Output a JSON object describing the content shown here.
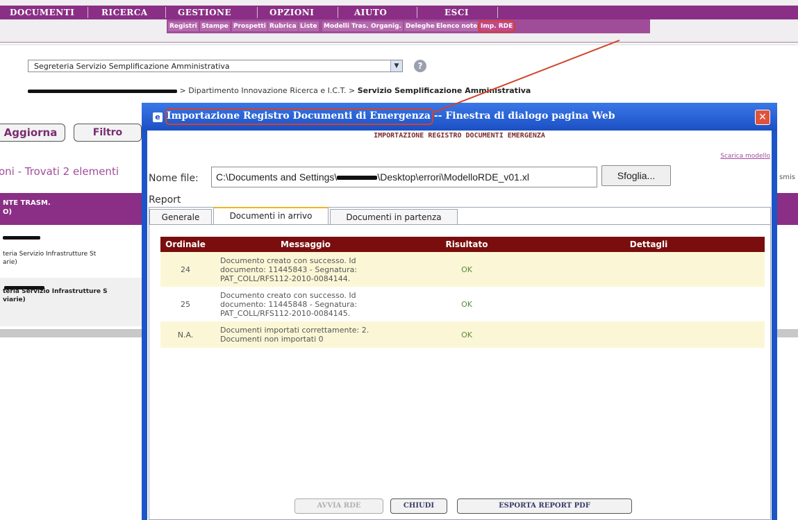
{
  "nav": {
    "main": [
      "DOCUMENTI",
      "RICERCA",
      "GESTIONE",
      "OPZIONI",
      "AIUTO",
      "ESCI"
    ],
    "sub": [
      "Registri",
      "Stampe",
      "Prospetti",
      "Rubrica",
      "Liste",
      "Modelli Tras.",
      "Organig.",
      "Deleghe",
      "Elenco note",
      "Imp. RDE"
    ]
  },
  "office": {
    "selected": "Segreteria Servizio Semplificazione Amministrativa",
    "breadcrumb_mid": "> Dipartimento Innovazione Ricerca e I.C.T. >",
    "breadcrumb_last": "Servizio Semplificazione Amministrativa"
  },
  "background": {
    "aggiorna_label": "Aggiorna",
    "filtro_label": "Filtro",
    "found_text": "oni - Trovati 2 elementi",
    "column_header_1": "NTE TRASM.",
    "column_header_2": "O)",
    "row1_line1": "teria Servizio Infrastrutture St",
    "row1_line2": "arie)",
    "row2_line1": "teria Servizio Infrastrutture S",
    "row2_line2": "viarie)",
    "right_fragment": "smis"
  },
  "dialog": {
    "title_main": "Importazione Registro Documenti di Emergenza",
    "title_suffix": " -- Finestra di dialogo pagina Web",
    "heading": "IMPORTAZIONE REGISTRO DOCUMENTI EMERGENZA",
    "scarica": "Scarica modello",
    "nome_label": "Nome file:",
    "file_prefix": "C:\\Documents and Settings\\",
    "file_suffix": "\\Desktop\\errori\\ModelloRDE_v01.xl",
    "sfoglia": "Sfoglia...",
    "report_label": "Report",
    "tabs": [
      "Generale",
      "Documenti in arrivo",
      "Documenti in partenza"
    ],
    "columns": [
      "Ordinale",
      "Messaggio",
      "Risultato",
      "Dettagli"
    ],
    "rows": [
      {
        "ordinale": "24",
        "messaggio_1": "Documento creato con successo. Id",
        "messaggio_2": "documento: 11445843 - Segnatura:",
        "messaggio_3": "PAT_COLL/RFS112-2010-0084144.",
        "risultato": "OK",
        "dettagli": ""
      },
      {
        "ordinale": "25",
        "messaggio_1": "Documento creato con successo. Id",
        "messaggio_2": "documento: 11445848 - Segnatura:",
        "messaggio_3": "PAT_COLL/RFS112-2010-0084145.",
        "risultato": "OK",
        "dettagli": ""
      },
      {
        "ordinale": "N.A.",
        "messaggio_1": "Documenti importati correttamente: 2.",
        "messaggio_2": "Documenti non importati 0",
        "messaggio_3": "",
        "risultato": "OK",
        "dettagli": ""
      }
    ],
    "buttons": {
      "avvia": "AVVIA RDE",
      "chiudi": "CHIUDI",
      "esporta": "ESPORTA REPORT PDF"
    }
  },
  "colors": {
    "purple": "#8a2f85",
    "dialog_blue": "#1d55c9",
    "table_header": "#7a0e0e",
    "highlight": "#d2432b"
  }
}
